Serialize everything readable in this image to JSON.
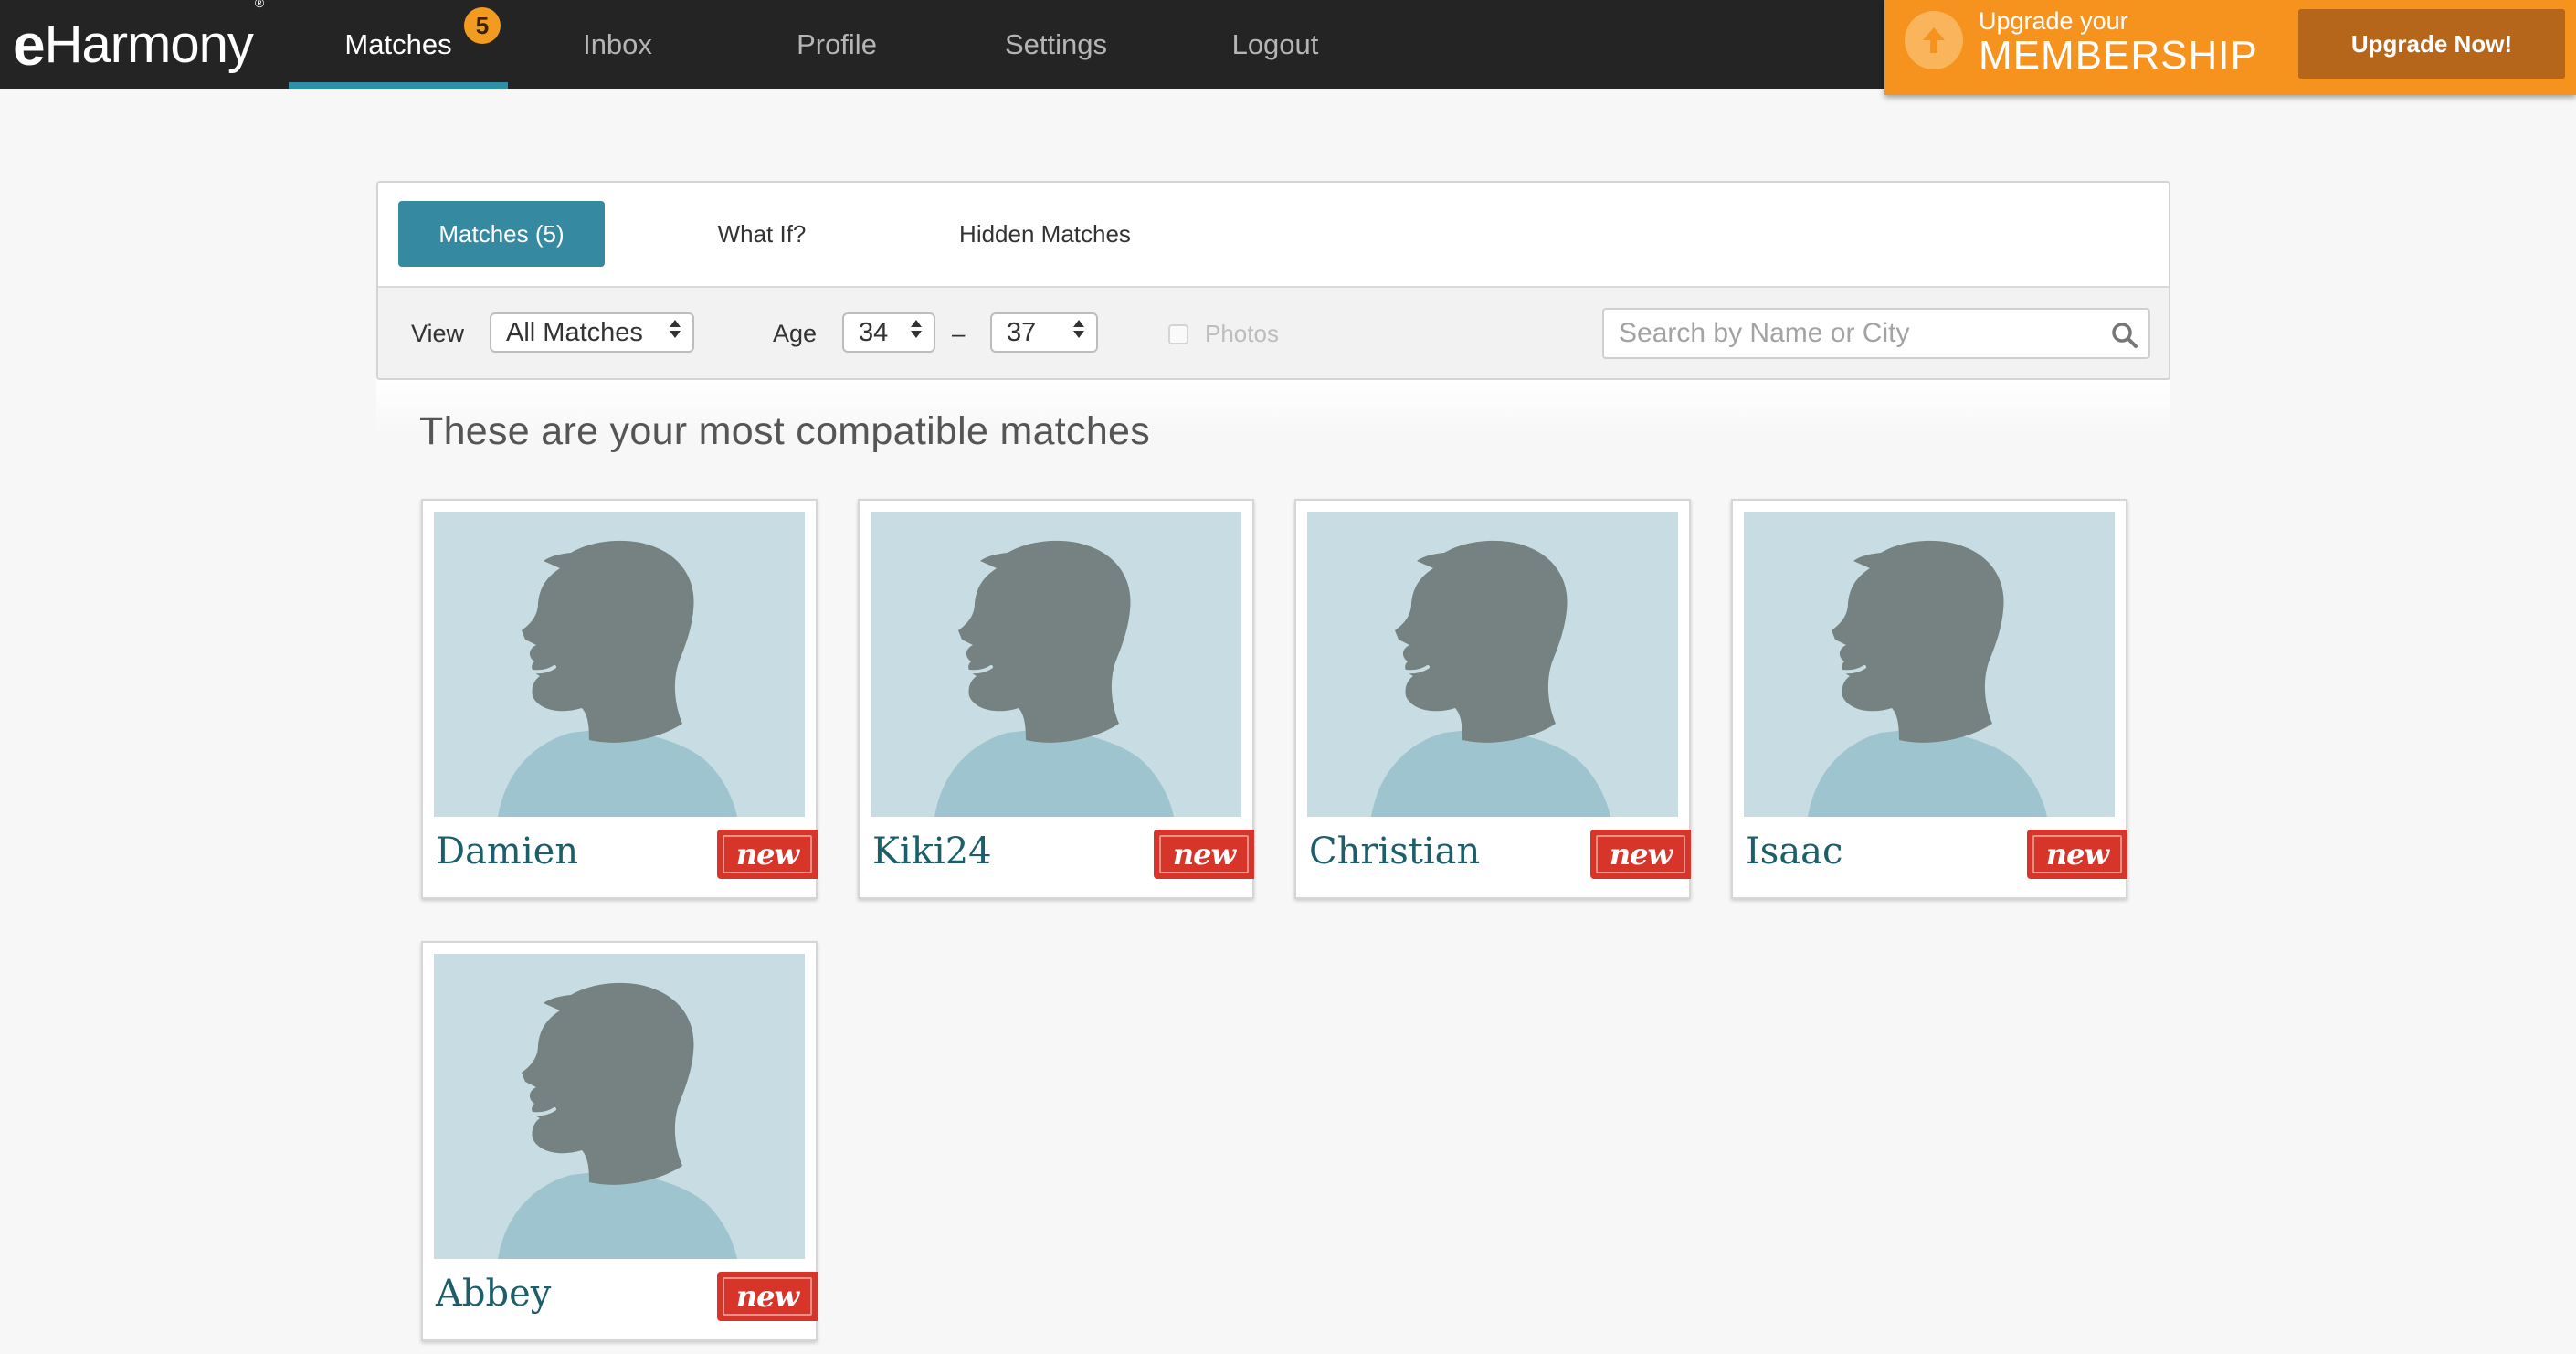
{
  "brand": {
    "logo_text": "Harmony",
    "logo_e": "e",
    "logo_tm": "®"
  },
  "nav": {
    "items": [
      {
        "label": "Matches",
        "badge": "5",
        "active": true
      },
      {
        "label": "Inbox"
      },
      {
        "label": "Profile"
      },
      {
        "label": "Settings"
      },
      {
        "label": "Logout"
      }
    ]
  },
  "upgrade": {
    "line1": "Upgrade your",
    "line2": "MEMBERSHIP",
    "button_label": "Upgrade Now!"
  },
  "tabs": [
    {
      "label": "Matches (5)",
      "active": true
    },
    {
      "label": "What If?"
    },
    {
      "label": "Hidden Matches"
    }
  ],
  "filters": {
    "view_label": "View",
    "view_value": "All Matches",
    "age_label": "Age",
    "age_min": "34",
    "age_separator": "–",
    "age_max": "37",
    "photos_label": "Photos",
    "photos_checked": false,
    "search_placeholder": "Search by Name or City",
    "search_value": ""
  },
  "heading": "These are your most compatible matches",
  "matches": [
    {
      "name": "Damien",
      "badge": "new"
    },
    {
      "name": "Kiki24",
      "badge": "new"
    },
    {
      "name": "Christian",
      "badge": "new"
    },
    {
      "name": "Isaac",
      "badge": "new"
    },
    {
      "name": "Abbey",
      "badge": "new"
    }
  ],
  "colors": {
    "topbar": "#242424",
    "accent": "#3589a1",
    "upgrade_bg": "#f6921e",
    "upgrade_button": "#b5661a",
    "badge_red": "#d8352a",
    "name_teal": "#1c5f6a",
    "photo_bg": "#c8dde3",
    "silhouette": "#758281",
    "shirt": "#9ec5cf"
  }
}
